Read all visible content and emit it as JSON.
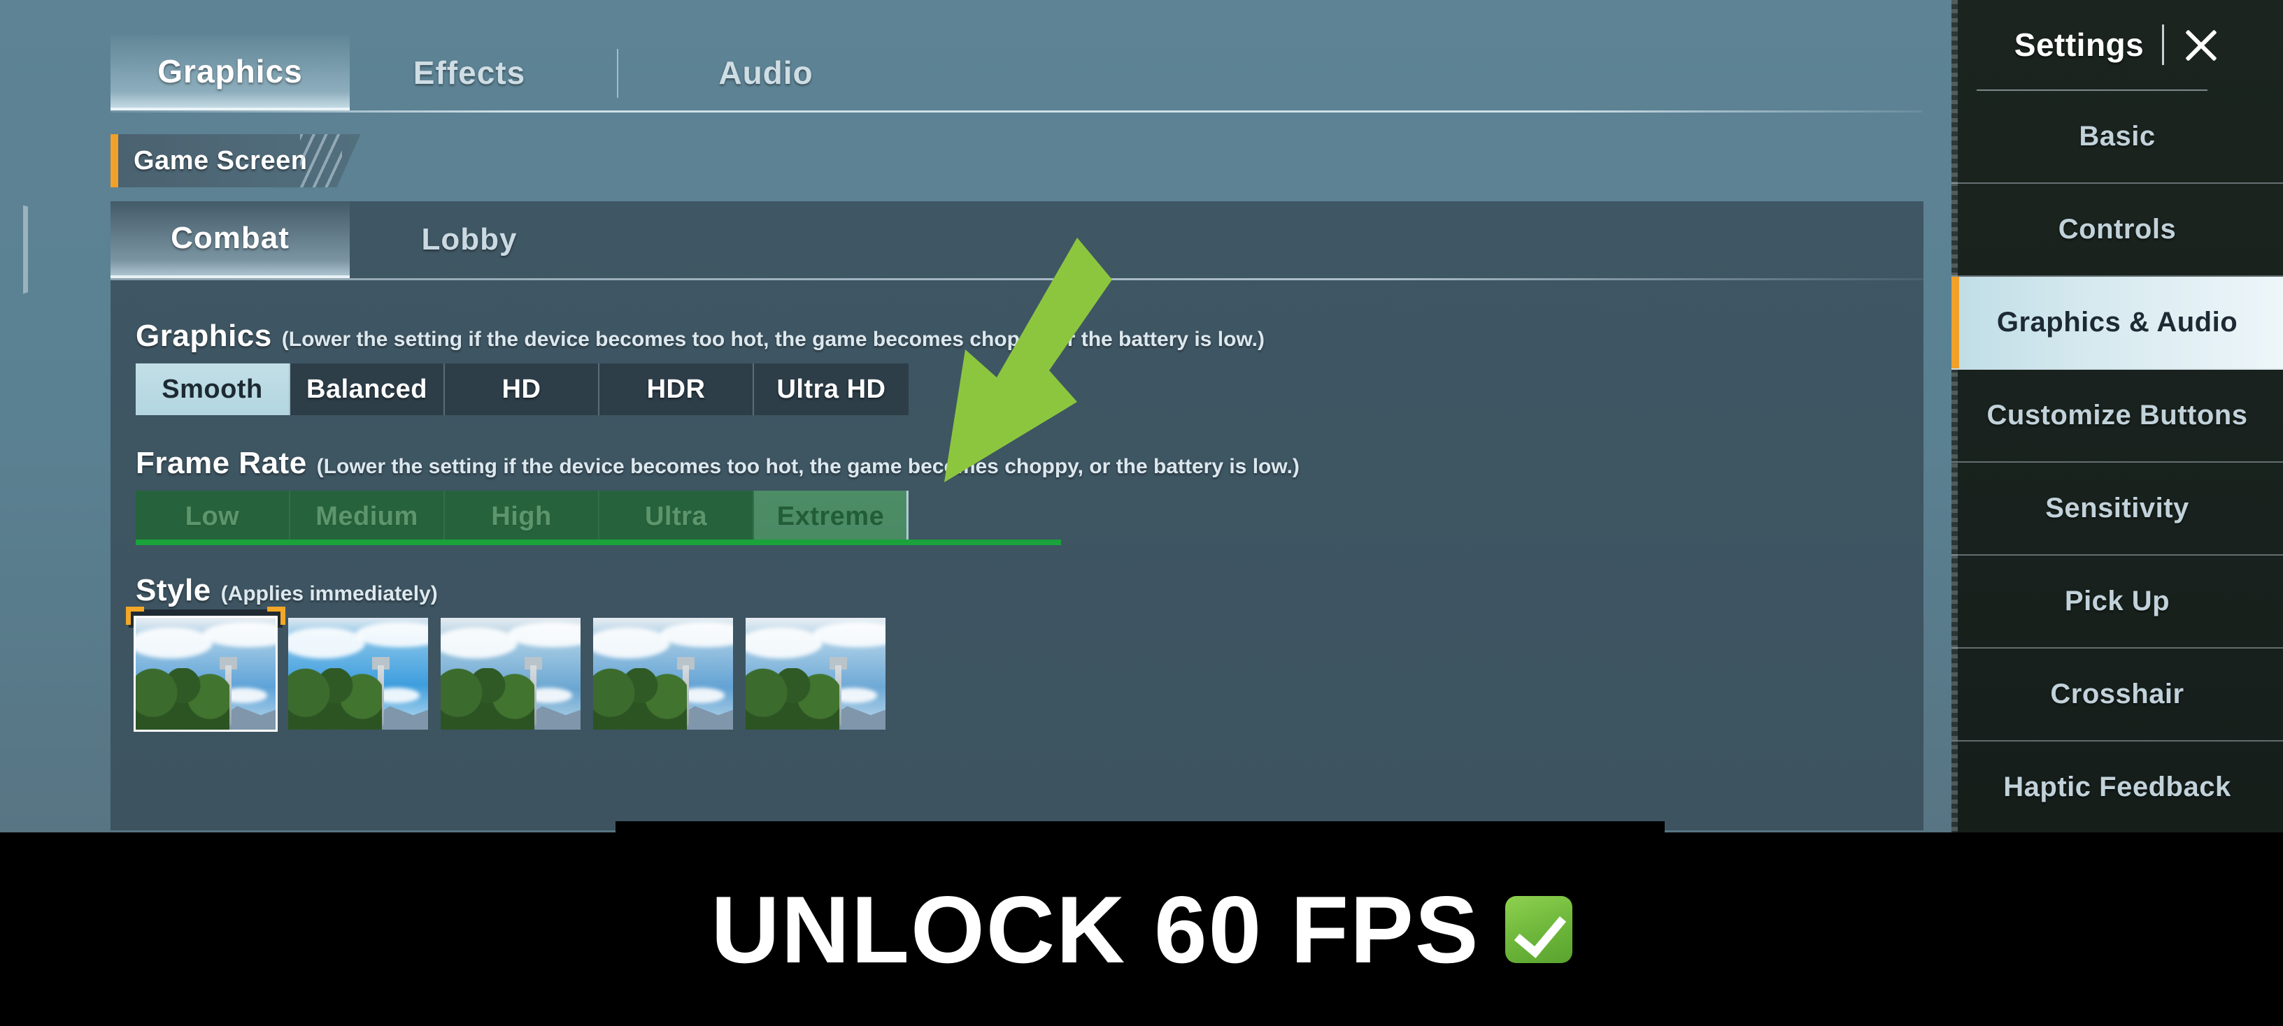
{
  "top_tabs": [
    {
      "label": "Graphics",
      "active": true
    },
    {
      "label": "Effects",
      "active": false
    },
    {
      "label": "Audio",
      "active": false
    }
  ],
  "section_header": {
    "label": "Game Screen"
  },
  "sub_tabs": [
    {
      "label": "Combat",
      "active": true
    },
    {
      "label": "Lobby",
      "active": false
    }
  ],
  "graphics_group": {
    "title": "Graphics",
    "description": "(Lower the setting if the device becomes too hot, the game becomes choppy, or the battery is low.)",
    "options": [
      {
        "label": "Smooth",
        "selected": true
      },
      {
        "label": "Balanced",
        "selected": false
      },
      {
        "label": "HD",
        "selected": false
      },
      {
        "label": "HDR",
        "selected": false
      },
      {
        "label": "Ultra HD",
        "selected": false
      }
    ]
  },
  "frame_rate_group": {
    "title": "Frame Rate",
    "description": "(Lower the setting if the device becomes too hot, the game becomes choppy, or the battery is low.)",
    "options": [
      {
        "label": "Low",
        "selected": false
      },
      {
        "label": "Medium",
        "selected": false
      },
      {
        "label": "High",
        "selected": false
      },
      {
        "label": "Ultra",
        "selected": false
      },
      {
        "label": "Extreme",
        "selected": true
      }
    ]
  },
  "style_group": {
    "title": "Style",
    "description": "(Applies immediately)",
    "thumbnails": [
      {
        "selected": true
      },
      {
        "selected": false
      },
      {
        "selected": false
      },
      {
        "selected": false
      },
      {
        "selected": false
      }
    ]
  },
  "sidebar": {
    "title": "Settings",
    "close_icon": "close-icon",
    "items": [
      {
        "label": "Basic",
        "active": false
      },
      {
        "label": "Controls",
        "active": false
      },
      {
        "label": "Graphics & Audio",
        "active": true
      },
      {
        "label": "Customize Buttons",
        "active": false
      },
      {
        "label": "Sensitivity",
        "active": false
      },
      {
        "label": "Pick Up",
        "active": false
      },
      {
        "label": "Crosshair",
        "active": false
      },
      {
        "label": "Haptic Feedback",
        "active": false
      }
    ]
  },
  "annotations": {
    "arrow_color": "#8CC63F",
    "highlight_color": "#19A33A",
    "arrow_icon": "arrow-down-left-icon"
  },
  "caption": {
    "text": "UNLOCK 60 FPS",
    "check_icon": "check-mark-badge-icon",
    "check_color": "#6CB63A"
  }
}
